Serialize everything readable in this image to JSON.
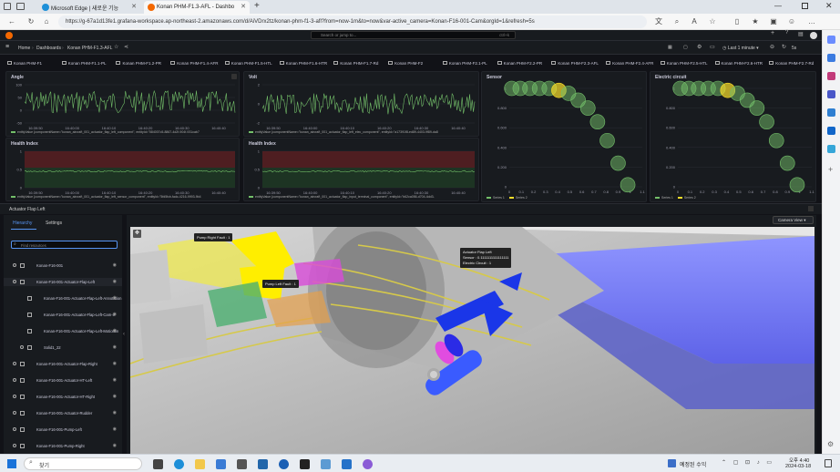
{
  "browser": {
    "tabs": [
      {
        "label": "Microsoft Edge | 새로운 기능"
      },
      {
        "label": "Konan PHM-F1.3-AFL - Dashbo"
      }
    ],
    "url": "https://g-67a1d13fe1.grafana-workspace.ap-northeast-2.amazonaws.com/d/AiVDrx2tz/konan-phm-f1-3-afl?from=now-1m&to=now&var-active_camera=Konan-F16-001-Cam&orgId=1&refresh=5s"
  },
  "grafana": {
    "search_placeholder": "Search or jump to...",
    "search_shortcut": "ctrl+k",
    "breadcrumb": [
      "Home",
      "Dashboards",
      "Konan PHM-F1.3-AFL"
    ],
    "time_picker": "Last 1 minute",
    "refresh": "5s",
    "dashboard_tags": [
      "Konan PHM-F1",
      "Konan PHM-F1.1-PL",
      "Konan PHM-F1.2-PR",
      "Konan PHM-F1.4-AFR",
      "Konan PHM-F1.5-HTL",
      "Konan PHM-F1.6-HTR",
      "Konan PHM-F1.7-Rd",
      "Konan PHM-F2",
      "Konan PHM-F2.1-PL",
      "Konan PHM-F2.2-PR",
      "Konan PHM-F2.3-AFL",
      "Konan PHM-F2.4-AFR",
      "Konan PHM-F2.5-HTL",
      "Konan PHM-F2.6-HTR",
      "Konan PHM-F2.7-Rd"
    ]
  },
  "panels": {
    "angle": {
      "title": "Angle",
      "yticks": [
        "100",
        "50",
        "0",
        "-50"
      ],
      "xticks": [
        "16:39:50",
        "16:40:00",
        "16:40:10",
        "16:40:20",
        "16:40:30",
        "16:40:40"
      ],
      "legend": "entityValue {componentName=\"konan_aircraft_001_actuator_flap_left_component\", entityId=\"584007c5-8867-4d2f-904f-931cab7"
    },
    "volt": {
      "title": "Volt",
      "yticks": [
        "2",
        "0",
        "-2"
      ],
      "xticks": [
        "16:39:50",
        "16:40:00",
        "16:40:10",
        "16:40:20",
        "16:40:30",
        "16:40:40"
      ],
      "legend": "entityValue {componentName=\"konan_aircraft_001_actuator_flap_left_elec_component\", entityId=\"a17391f8-ed89-4403-9f89-da8"
    },
    "sensor": {
      "title": "Sensor",
      "yticks": [
        "1",
        "0.800",
        "0.600",
        "0.400",
        "0.200",
        "0"
      ],
      "xticks": [
        "0",
        "0.1",
        "0.2",
        "0.3",
        "0.4",
        "0.5",
        "0.6",
        "0.7",
        "0.8",
        "0.9",
        "1",
        "1.1"
      ],
      "legend": [
        "Series 1",
        "Series 2"
      ]
    },
    "electric": {
      "title": "Electric circuit",
      "yticks": [
        "1",
        "0.800",
        "0.600",
        "0.400",
        "0.200",
        "0"
      ],
      "xticks": [
        "0",
        "0.1",
        "0.2",
        "0.3",
        "0.4",
        "0.5",
        "0.6",
        "0.7",
        "0.8",
        "0.9",
        "1",
        "1.1"
      ],
      "legend": [
        "Series 1",
        "Series 2"
      ]
    },
    "health1": {
      "title": "Health Index",
      "yticks": [
        "1",
        "0.5",
        "0"
      ],
      "xticks": [
        "16:39:50",
        "16:40:00",
        "16:40:10",
        "16:40:20",
        "16:40:30",
        "16:40:40"
      ],
      "legend": "entityValue {componentName=\"konan_aircraft_001_actuator_flap_left_sensor_component\", entityId=\"5fd5fcb-fadc-4216-9993-9b4"
    },
    "health2": {
      "title": "Health Index",
      "yticks": [
        "1",
        "0.5",
        "0"
      ],
      "xticks": [
        "16:39:50",
        "16:40:00",
        "16:40:10",
        "16:40:20",
        "16:40:30",
        "16:40:40"
      ],
      "legend": "entityValue {componentName=\"konan_aircraft_001_actuator_flap_input_terminal_component\", entityId=\"b62ca056-d704-4dd3-"
    }
  },
  "chart_data": [
    {
      "type": "scatter",
      "title": "Sensor",
      "x": [
        0.02,
        0.09,
        0.17,
        0.25,
        0.33,
        0.41,
        0.49,
        0.57,
        0.65,
        0.73,
        0.81,
        0.9,
        0.98
      ],
      "y": [
        1.0,
        1.0,
        1.0,
        1.0,
        1.0,
        0.98,
        0.95,
        0.88,
        0.8,
        0.66,
        0.47,
        0.24,
        0.02
      ],
      "highlight_index": 5,
      "ylim": [
        0,
        1
      ],
      "xlim": [
        0,
        1.1
      ]
    },
    {
      "type": "scatter",
      "title": "Electric circuit",
      "x": [
        0.02,
        0.09,
        0.17,
        0.25,
        0.33,
        0.41,
        0.49,
        0.57,
        0.65,
        0.73,
        0.81,
        0.9,
        0.98
      ],
      "y": [
        1.0,
        1.0,
        1.0,
        1.0,
        1.0,
        0.98,
        0.95,
        0.88,
        0.8,
        0.66,
        0.47,
        0.24,
        0.02
      ],
      "highlight_index": 5,
      "ylim": [
        0,
        1
      ],
      "xlim": [
        0,
        1.1
      ]
    }
  ],
  "scene": {
    "panel_title": "Actuator Flap Left",
    "tabs": [
      "Hierarchy",
      "Settings"
    ],
    "find_placeholder": "Find resources",
    "camera_button": "Camera View",
    "items": [
      "Konan-F16-001",
      "Konan-F16-001-Actuator-Flap-Left",
      "Konan-F16-001-Actuator-Flap-Left-Annotation",
      "Konan-F16-001-Actuator-Flap-Left-Cam-ir",
      "Konan-F16-001-Actuator-Flap-Left-Motionlin",
      "Solid1_22",
      "Konan-F16-001-Actuator-Flap-Right",
      "Konan-F16-001-Actuator-HT-Left",
      "Konan-F16-001-Actuator-HT-Right",
      "Konan-F16-001-Actuator-Rudder",
      "Konan-F16-001-Pump-Left",
      "Konan-F16-001-Pump-Right"
    ],
    "tooltips": {
      "pump_right": "Pump Right Fault : 1",
      "pump_left": "Pump Left Fault : 1",
      "actuator_title": "Actuator Flap Left",
      "actuator_sensor": "Sensor : 0.1111111111111111",
      "actuator_elec": "Electric Circuit : 1"
    }
  },
  "taskbar": {
    "search": "찾기",
    "weather": "예정된 수익",
    "time": "오후 4:40",
    "date": "2024-03-18"
  }
}
